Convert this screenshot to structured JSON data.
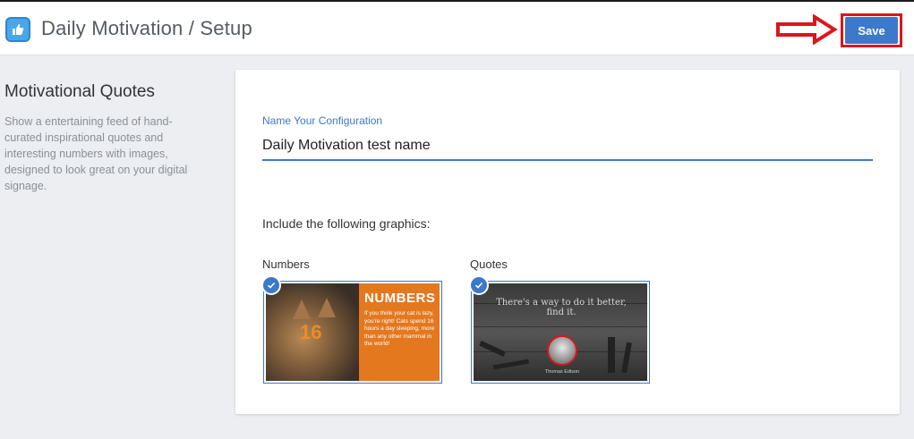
{
  "header": {
    "title": "Daily Motivation / Setup",
    "save_label": "Save"
  },
  "sidebar": {
    "title": "Motivational Quotes",
    "description": "Show a entertaining feed of hand-curated inspirational quotes and interesting numbers with images, designed to look great on your digital signage."
  },
  "form": {
    "name_label": "Name Your Configuration",
    "name_value": "Daily Motivation test name",
    "include_label": "Include the following graphics:"
  },
  "graphics": [
    {
      "label": "Numbers",
      "checked": true,
      "thumb_number": "16",
      "thumb_title": "NUMBERS",
      "thumb_text": "If you think your cat is lazy, you're right! Cats spend 16 hours a day sleeping, more than any other mammal in the world!"
    },
    {
      "label": "Quotes",
      "checked": true,
      "thumb_quote": "There's a way to do it better, find it.",
      "thumb_author": "Thomas Edison"
    }
  ],
  "colors": {
    "accent": "#3d78c9",
    "highlight": "#d9161c",
    "orange": "#e3781f"
  }
}
